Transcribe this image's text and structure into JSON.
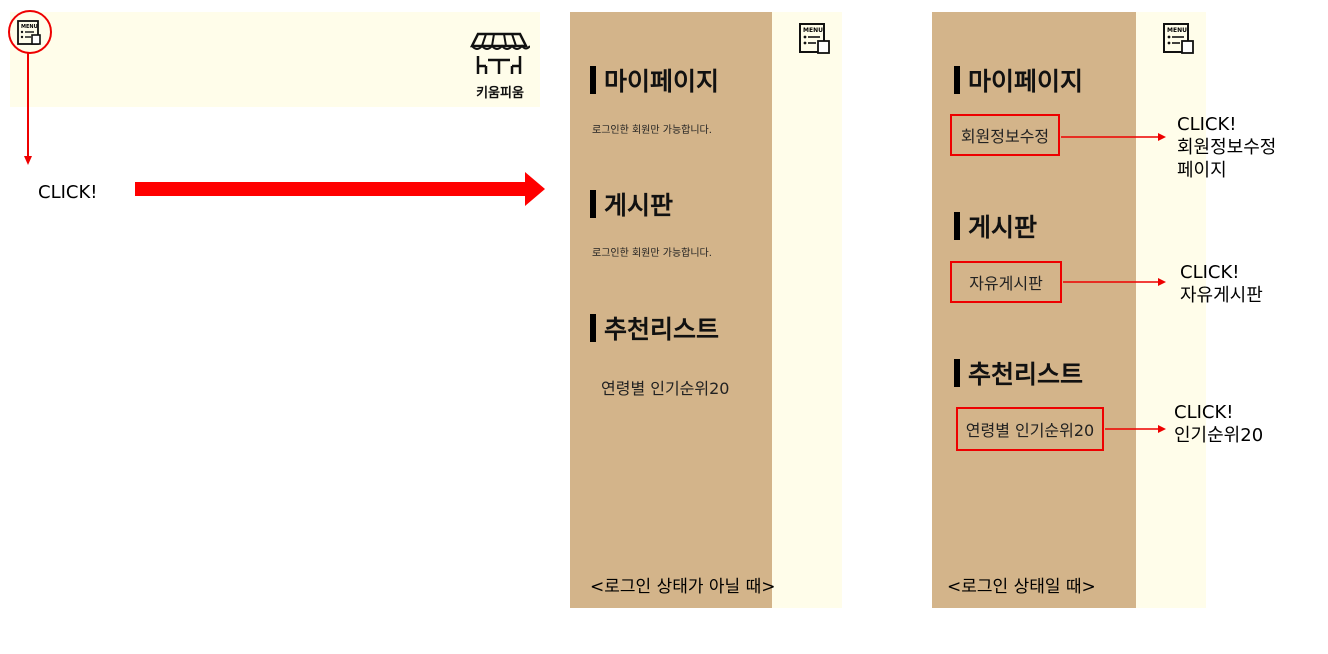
{
  "left": {
    "brand_name": "키움피움",
    "click_label": "CLICK!"
  },
  "panel_logged_out": {
    "mypage": {
      "title": "마이페이지",
      "note": "로그인한 회원만 가능합니다."
    },
    "board": {
      "title": "게시판",
      "note": "로그인한 회원만 가능합니다."
    },
    "recommend": {
      "title": "추천리스트",
      "item": "연령별 인기순위20"
    },
    "caption": "<로그인 상태가 아닐 때>"
  },
  "panel_logged_in": {
    "mypage": {
      "title": "마이페이지",
      "item": "회원정보수정"
    },
    "board": {
      "title": "게시판",
      "item": "자유게시판"
    },
    "recommend": {
      "title": "추천리스트",
      "item": "연령별 인기순위20"
    },
    "caption": "<로그인 상태일 때>"
  },
  "callouts": [
    {
      "click": "CLICK!",
      "lines": [
        "회원정보수정",
        "페이지"
      ]
    },
    {
      "click": "CLICK!",
      "lines": [
        "자유게시판"
      ]
    },
    {
      "click": "CLICK!",
      "lines": [
        "인기순위20"
      ]
    }
  ],
  "colors": {
    "panel": "#d3b48a",
    "background": "#fffdea",
    "accent": "#e00000"
  }
}
